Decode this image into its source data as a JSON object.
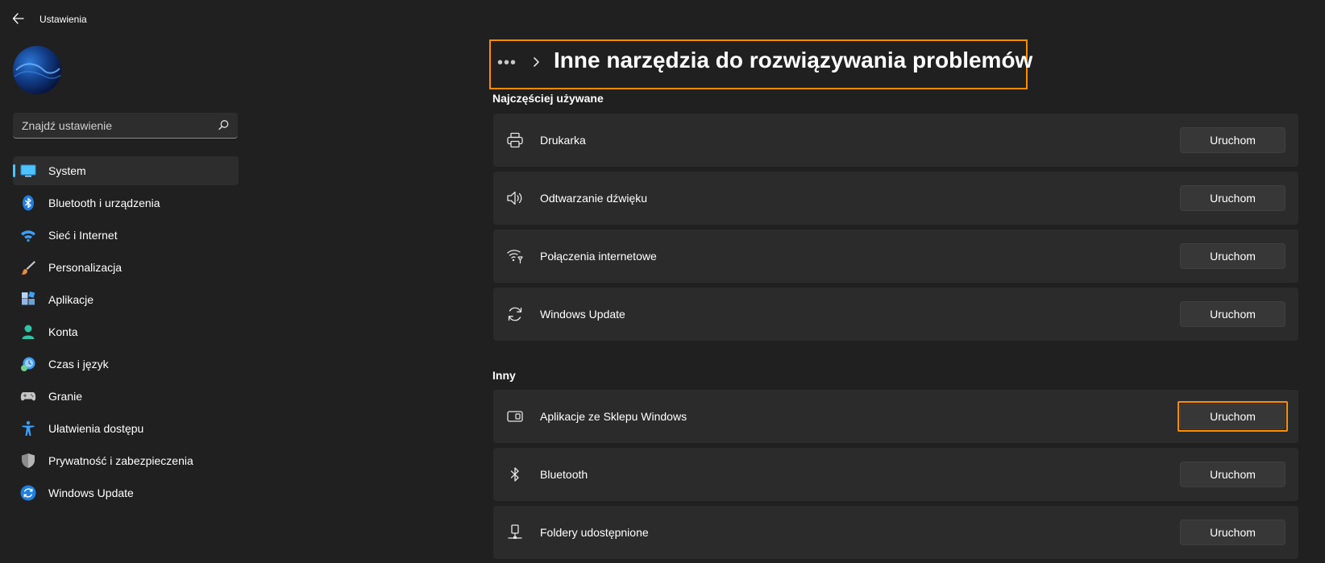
{
  "app": {
    "title": "Ustawienia"
  },
  "search": {
    "placeholder": "Znajdź ustawienie"
  },
  "sidebar": {
    "items": [
      {
        "label": "System",
        "icon": "monitor-icon",
        "selected": true
      },
      {
        "label": "Bluetooth i urządzenia",
        "icon": "bluetooth-icon"
      },
      {
        "label": "Sieć i Internet",
        "icon": "wifi-icon"
      },
      {
        "label": "Personalizacja",
        "icon": "brush-icon"
      },
      {
        "label": "Aplikacje",
        "icon": "apps-icon"
      },
      {
        "label": "Konta",
        "icon": "person-icon"
      },
      {
        "label": "Czas i język",
        "icon": "clock-globe-icon"
      },
      {
        "label": "Granie",
        "icon": "gamepad-icon"
      },
      {
        "label": "Ułatwienia dostępu",
        "icon": "accessibility-icon"
      },
      {
        "label": "Prywatność i zabezpieczenia",
        "icon": "shield-icon"
      },
      {
        "label": "Windows Update",
        "icon": "update-icon"
      }
    ]
  },
  "breadcrumb": {
    "more": "•••",
    "title": "Inne narzędzia do rozwiązywania problemów"
  },
  "sections": {
    "frequent": {
      "title": "Najczęściej używane",
      "rows": [
        {
          "label": "Drukarka",
          "icon": "printer-icon",
          "button": "Uruchom"
        },
        {
          "label": "Odtwarzanie dźwięku",
          "icon": "speaker-icon",
          "button": "Uruchom"
        },
        {
          "label": "Połączenia internetowe",
          "icon": "wifi-signal-icon",
          "button": "Uruchom"
        },
        {
          "label": "Windows Update",
          "icon": "sync-icon",
          "button": "Uruchom"
        }
      ]
    },
    "other": {
      "title": "Inny",
      "rows": [
        {
          "label": "Aplikacje ze Sklepu Windows",
          "icon": "store-app-icon",
          "button": "Uruchom"
        },
        {
          "label": "Bluetooth",
          "icon": "bluetooth-icon",
          "button": "Uruchom"
        },
        {
          "label": "Foldery udostępnione",
          "icon": "network-share-icon",
          "button": "Uruchom"
        }
      ]
    }
  },
  "colors": {
    "accent": "#4cc2ff",
    "highlight": "#ff8c00",
    "background": "#202020",
    "card": "#2b2b2b"
  }
}
